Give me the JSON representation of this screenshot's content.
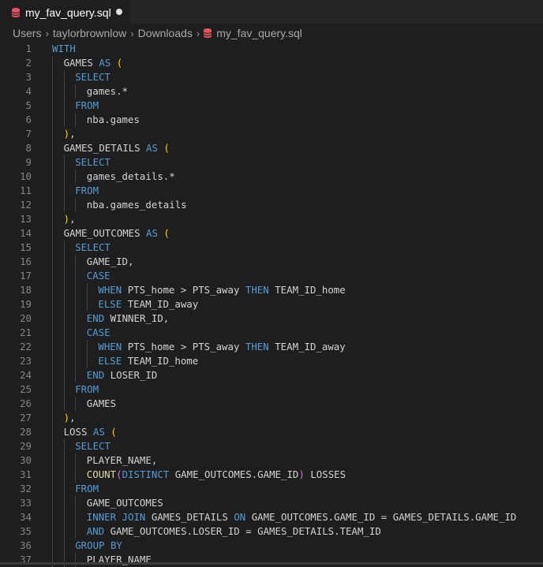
{
  "tab": {
    "label": "my_fav_query.sql"
  },
  "breadcrumb": {
    "items": [
      "Users",
      "taylorbrownlow",
      "Downloads",
      "my_fav_query.sql"
    ]
  },
  "colors": {
    "keyword": "#569cd6",
    "bracket": "#ffd700",
    "function": "#dcdcaa",
    "bracket2": "#da70d6",
    "sql_icon": "#e05561"
  },
  "code_lines": [
    {
      "n": "1",
      "indent": 0,
      "tokens": [
        [
          "kw",
          "WITH"
        ]
      ]
    },
    {
      "n": "2",
      "indent": 1,
      "tokens": [
        [
          "",
          "GAMES "
        ],
        [
          "kw",
          "AS"
        ],
        [
          "",
          " "
        ],
        [
          "pn",
          "("
        ]
      ]
    },
    {
      "n": "3",
      "indent": 2,
      "tokens": [
        [
          "kw",
          "SELECT"
        ]
      ]
    },
    {
      "n": "4",
      "indent": 3,
      "tokens": [
        [
          "",
          "games.*"
        ]
      ]
    },
    {
      "n": "5",
      "indent": 2,
      "tokens": [
        [
          "kw",
          "FROM"
        ]
      ]
    },
    {
      "n": "6",
      "indent": 3,
      "tokens": [
        [
          "",
          "nba.games"
        ]
      ]
    },
    {
      "n": "7",
      "indent": 1,
      "tokens": [
        [
          "pn",
          ")"
        ],
        [
          "",
          ","
        ]
      ]
    },
    {
      "n": "8",
      "indent": 1,
      "tokens": [
        [
          "",
          "GAMES_DETAILS "
        ],
        [
          "kw",
          "AS"
        ],
        [
          "",
          " "
        ],
        [
          "pn",
          "("
        ]
      ]
    },
    {
      "n": "9",
      "indent": 2,
      "tokens": [
        [
          "kw",
          "SELECT"
        ]
      ]
    },
    {
      "n": "10",
      "indent": 3,
      "tokens": [
        [
          "",
          "games_details.*"
        ]
      ]
    },
    {
      "n": "11",
      "indent": 2,
      "tokens": [
        [
          "kw",
          "FROM"
        ]
      ]
    },
    {
      "n": "12",
      "indent": 3,
      "tokens": [
        [
          "",
          "nba.games_details"
        ]
      ]
    },
    {
      "n": "13",
      "indent": 1,
      "tokens": [
        [
          "pn",
          ")"
        ],
        [
          "",
          ","
        ]
      ]
    },
    {
      "n": "14",
      "indent": 1,
      "tokens": [
        [
          "",
          "GAME_OUTCOMES "
        ],
        [
          "kw",
          "AS"
        ],
        [
          "",
          " "
        ],
        [
          "pn",
          "("
        ]
      ]
    },
    {
      "n": "15",
      "indent": 2,
      "tokens": [
        [
          "kw",
          "SELECT"
        ]
      ]
    },
    {
      "n": "16",
      "indent": 3,
      "tokens": [
        [
          "",
          "GAME_ID,"
        ]
      ]
    },
    {
      "n": "17",
      "indent": 3,
      "tokens": [
        [
          "kw",
          "CASE"
        ]
      ]
    },
    {
      "n": "18",
      "indent": 4,
      "tokens": [
        [
          "kw",
          "WHEN"
        ],
        [
          "",
          " PTS_home > PTS_away "
        ],
        [
          "kw",
          "THEN"
        ],
        [
          "",
          " TEAM_ID_home"
        ]
      ]
    },
    {
      "n": "19",
      "indent": 4,
      "tokens": [
        [
          "kw",
          "ELSE"
        ],
        [
          "",
          " TEAM_ID_away"
        ]
      ]
    },
    {
      "n": "20",
      "indent": 3,
      "tokens": [
        [
          "kw",
          "END"
        ],
        [
          "",
          " WINNER_ID,"
        ]
      ]
    },
    {
      "n": "21",
      "indent": 3,
      "tokens": [
        [
          "kw",
          "CASE"
        ]
      ]
    },
    {
      "n": "22",
      "indent": 4,
      "tokens": [
        [
          "kw",
          "WHEN"
        ],
        [
          "",
          " PTS_home > PTS_away "
        ],
        [
          "kw",
          "THEN"
        ],
        [
          "",
          " TEAM_ID_away"
        ]
      ]
    },
    {
      "n": "23",
      "indent": 4,
      "tokens": [
        [
          "kw",
          "ELSE"
        ],
        [
          "",
          " TEAM_ID_home"
        ]
      ]
    },
    {
      "n": "24",
      "indent": 3,
      "tokens": [
        [
          "kw",
          "END"
        ],
        [
          "",
          " LOSER_ID"
        ]
      ]
    },
    {
      "n": "25",
      "indent": 2,
      "tokens": [
        [
          "kw",
          "FROM"
        ]
      ]
    },
    {
      "n": "26",
      "indent": 3,
      "tokens": [
        [
          "",
          "GAMES"
        ]
      ]
    },
    {
      "n": "27",
      "indent": 1,
      "tokens": [
        [
          "pn",
          ")"
        ],
        [
          "",
          ","
        ]
      ]
    },
    {
      "n": "28",
      "indent": 1,
      "tokens": [
        [
          "",
          "LOSS "
        ],
        [
          "kw",
          "AS"
        ],
        [
          "",
          " "
        ],
        [
          "pn",
          "("
        ]
      ]
    },
    {
      "n": "29",
      "indent": 2,
      "tokens": [
        [
          "kw",
          "SELECT"
        ]
      ]
    },
    {
      "n": "30",
      "indent": 3,
      "tokens": [
        [
          "",
          "PLAYER_NAME,"
        ]
      ]
    },
    {
      "n": "31",
      "indent": 3,
      "tokens": [
        [
          "fn",
          "COUNT"
        ],
        [
          "pn2",
          "("
        ],
        [
          "kw",
          "DISTINCT"
        ],
        [
          "",
          " GAME_OUTCOMES.GAME_ID"
        ],
        [
          "pn2",
          ")"
        ],
        [
          "",
          " LOSSES"
        ]
      ]
    },
    {
      "n": "32",
      "indent": 2,
      "tokens": [
        [
          "kw",
          "FROM"
        ]
      ]
    },
    {
      "n": "33",
      "indent": 3,
      "tokens": [
        [
          "",
          "GAME_OUTCOMES"
        ]
      ]
    },
    {
      "n": "34",
      "indent": 3,
      "tokens": [
        [
          "kw",
          "INNER JOIN"
        ],
        [
          "",
          " GAMES_DETAILS "
        ],
        [
          "kw",
          "ON"
        ],
        [
          "",
          " GAME_OUTCOMES.GAME_ID = GAMES_DETAILS.GAME_ID"
        ]
      ]
    },
    {
      "n": "35",
      "indent": 3,
      "tokens": [
        [
          "kw",
          "AND"
        ],
        [
          "",
          " GAME_OUTCOMES.LOSER_ID = GAMES_DETAILS.TEAM_ID"
        ]
      ]
    },
    {
      "n": "36",
      "indent": 2,
      "tokens": [
        [
          "kw",
          "GROUP BY"
        ]
      ]
    },
    {
      "n": "37",
      "indent": 3,
      "tokens": [
        [
          "",
          "PLAYER_NAME"
        ]
      ]
    }
  ]
}
